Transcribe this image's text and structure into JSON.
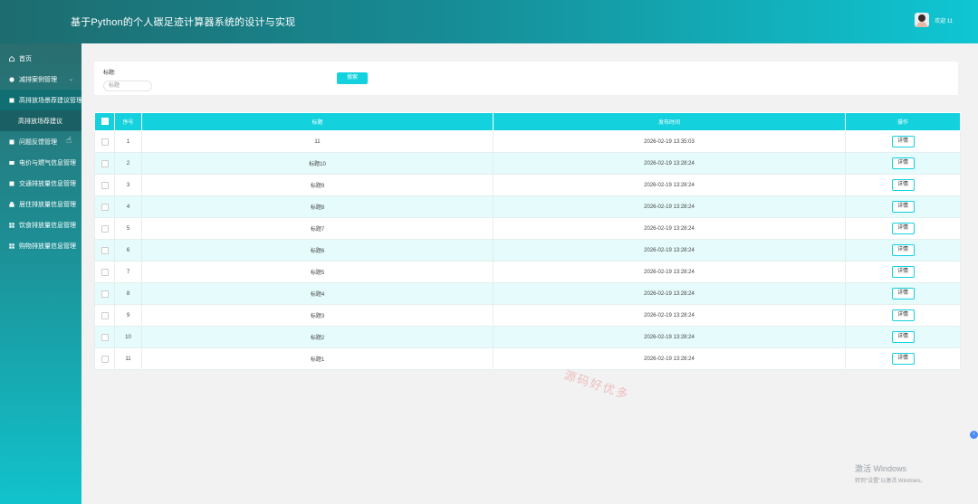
{
  "header": {
    "title": "基于Python的个人碳足迹计算器系统的设计与实现",
    "user_label": "欢迎 11"
  },
  "sidebar": {
    "items": [
      {
        "label": "首页",
        "icon": "home-icon"
      },
      {
        "label": "减排案例管理",
        "icon": "bulb-icon",
        "chevron": "⌄"
      },
      {
        "label": "高排放场景荐建议管理",
        "icon": "square-icon",
        "active": true
      },
      {
        "label": "问题反馈管理",
        "icon": "square-icon"
      },
      {
        "label": "电价与燃气信息管理",
        "icon": "card-icon"
      },
      {
        "label": "交通排放量信息管理",
        "icon": "square-icon"
      },
      {
        "label": "居住排放量信息管理",
        "icon": "print-icon"
      },
      {
        "label": "饮食排放量信息管理",
        "icon": "grid-icon"
      },
      {
        "label": "购物排放量信息管理",
        "icon": "grid-icon"
      }
    ],
    "submenu": "高排放场荐建议"
  },
  "search": {
    "label": "标题:",
    "placeholder": "标题",
    "button": "搜索"
  },
  "table": {
    "headers": [
      "",
      "序号",
      "标题",
      "发布时间",
      "操作"
    ],
    "action_label": "详情",
    "rows": [
      {
        "no": "1",
        "title": "11",
        "time": "2026-02-19 13:35:03"
      },
      {
        "no": "2",
        "title": "标题10",
        "time": "2026-02-19 13:28:24"
      },
      {
        "no": "3",
        "title": "标题9",
        "time": "2026-02-19 13:28:24"
      },
      {
        "no": "4",
        "title": "标题8",
        "time": "2026-02-19 13:28:24"
      },
      {
        "no": "5",
        "title": "标题7",
        "time": "2026-02-19 13:28:24"
      },
      {
        "no": "6",
        "title": "标题6",
        "time": "2026-02-19 13:28:24"
      },
      {
        "no": "7",
        "title": "标题5",
        "time": "2026-02-19 13:28:24"
      },
      {
        "no": "8",
        "title": "标题4",
        "time": "2026-02-19 13:28:24"
      },
      {
        "no": "9",
        "title": "标题3",
        "time": "2026-02-19 13:28:24"
      },
      {
        "no": "10",
        "title": "标题2",
        "time": "2026-02-19 13:28:24"
      },
      {
        "no": "11",
        "title": "标题1",
        "time": "2026-02-19 13:28:24"
      }
    ]
  },
  "watermark": "源码好优多",
  "activate": {
    "line1": "激活 Windows",
    "line2": "转到\"设置\"以激活 Windows。"
  },
  "colors": {
    "accent": "#13d2dd",
    "header_start": "#1d6c6f",
    "header_end": "#0fc6d3"
  }
}
